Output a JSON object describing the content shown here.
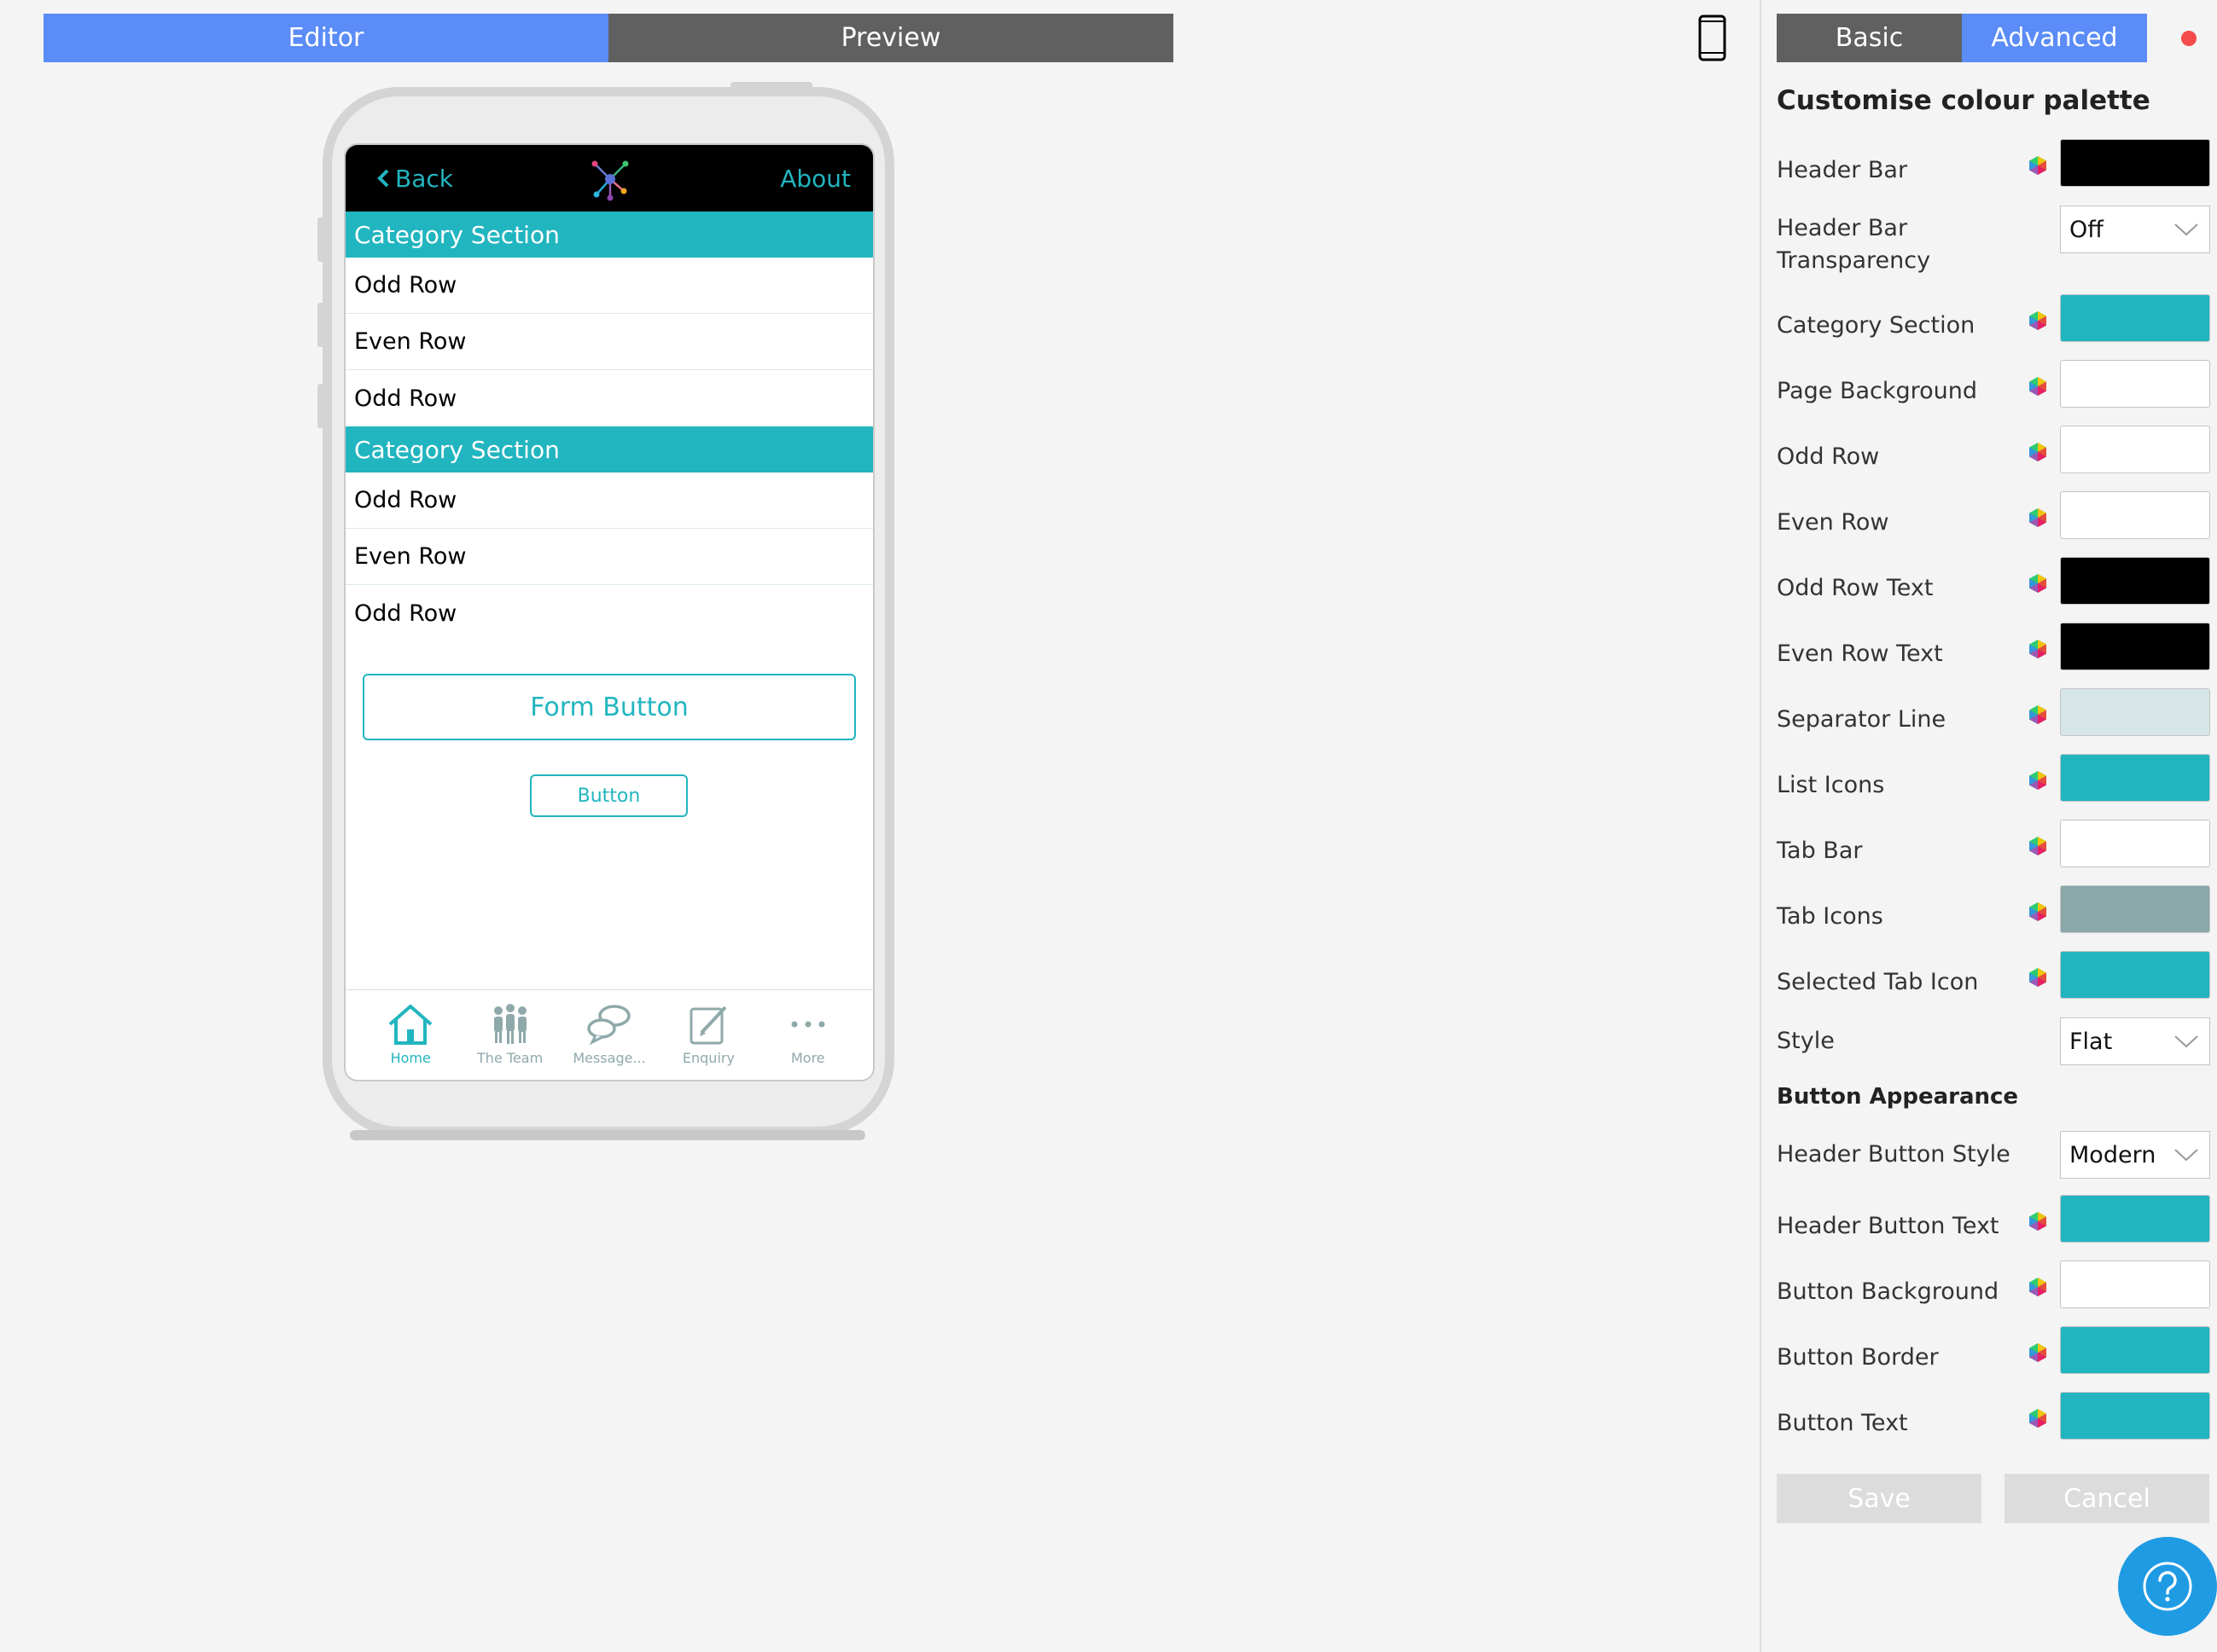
{
  "mode_tabs": {
    "editor": "Editor",
    "preview": "Preview"
  },
  "device_icon": "smartphone-icon",
  "app": {
    "header": {
      "back": "Back",
      "about": "About",
      "logo": "network-logo-icon"
    },
    "sections": [
      {
        "title": "Category Section",
        "rows": [
          "Odd Row",
          "Even Row",
          "Odd Row"
        ]
      },
      {
        "title": "Category Section",
        "rows": [
          "Odd Row",
          "Even Row",
          "Odd Row"
        ]
      }
    ],
    "form_button": "Form Button",
    "button": "Button",
    "tabs": [
      {
        "label": "Home",
        "icon": "home-icon",
        "selected": true
      },
      {
        "label": "The Team",
        "icon": "team-icon",
        "selected": false
      },
      {
        "label": "Message...",
        "icon": "chat-icon",
        "selected": false
      },
      {
        "label": "Enquiry",
        "icon": "edit-icon",
        "selected": false
      },
      {
        "label": "More",
        "icon": "more-icon",
        "selected": false
      }
    ],
    "colors": {
      "accent": "#21b5c0",
      "header": "#000000",
      "tab_icon": "#8fa9ab"
    }
  },
  "panel": {
    "tabs": {
      "basic": "Basic",
      "advanced": "Advanced"
    },
    "title": "Customise colour palette",
    "fields": {
      "header_bar": {
        "label": "Header Bar",
        "color": "#000000"
      },
      "header_bar_transparency": {
        "label": "Header Bar Transparency",
        "value": "Off"
      },
      "category_section": {
        "label": "Category Section",
        "color": "#21b5c0"
      },
      "page_background": {
        "label": "Page Background",
        "color": "#ffffff"
      },
      "odd_row": {
        "label": "Odd Row",
        "color": "#ffffff"
      },
      "even_row": {
        "label": "Even Row",
        "color": "#ffffff"
      },
      "odd_row_text": {
        "label": "Odd Row Text",
        "color": "#000000"
      },
      "even_row_text": {
        "label": "Even Row Text",
        "color": "#000000"
      },
      "separator_line": {
        "label": "Separator Line",
        "color": "#d6e5e8"
      },
      "list_icons": {
        "label": "List Icons",
        "color": "#21b5c0"
      },
      "tab_bar": {
        "label": "Tab Bar",
        "color": "#ffffff"
      },
      "tab_icons": {
        "label": "Tab Icons",
        "color": "#8aa8aa"
      },
      "selected_tab_icon": {
        "label": "Selected Tab Icon",
        "color": "#21b5c0"
      },
      "style": {
        "label": "Style",
        "value": "Flat"
      }
    },
    "button_appearance": {
      "title": "Button Appearance",
      "header_button_style": {
        "label": "Header Button Style",
        "value": "Modern"
      },
      "header_button_text": {
        "label": "Header Button Text",
        "color": "#21b5c0"
      },
      "button_background": {
        "label": "Button Background",
        "color": "#ffffff"
      },
      "button_border": {
        "label": "Button Border",
        "color": "#21b5c0"
      },
      "button_text": {
        "label": "Button Text",
        "color": "#21b5c0"
      }
    },
    "actions": {
      "save": "Save",
      "cancel": "Cancel"
    },
    "help_icon": "help-question-icon"
  }
}
